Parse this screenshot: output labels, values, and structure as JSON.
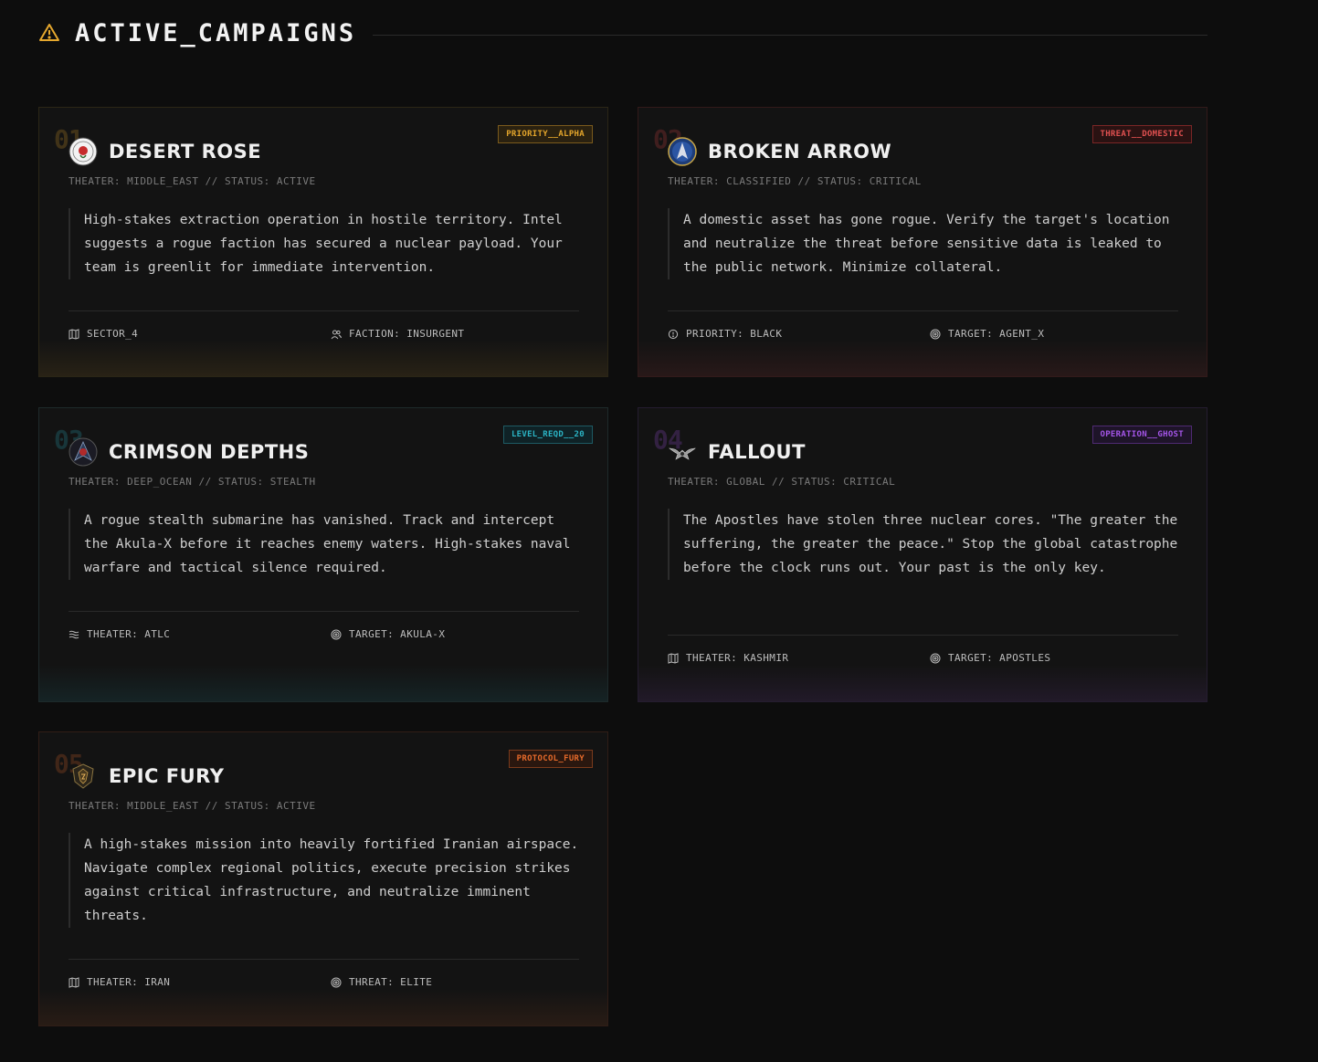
{
  "header": {
    "title": "ACTIVE_CAMPAIGNS"
  },
  "campaigns": [
    {
      "num": "01",
      "title": "DESERT ROSE",
      "meta": "THEATER: MIDDLE_EAST // STATUS: ACTIVE",
      "badge": "PRIORITY__ALPHA",
      "description": "High-stakes extraction operation in hostile territory. Intel suggests a rogue faction has secured a nuclear payload. Your team is greenlit for immediate intervention.",
      "foot_left": "SECTOR_4",
      "foot_right": "FACTION: INSURGENT",
      "accent": "#e2a42b"
    },
    {
      "num": "02",
      "title": "BROKEN ARROW",
      "meta": "THEATER: CLASSIFIED // STATUS: CRITICAL",
      "badge": "THREAT__DOMESTIC",
      "description": "A domestic asset has gone rogue. Verify the target's location and neutralize the threat before sensitive data is leaked to the public network. Minimize collateral.",
      "foot_left": "PRIORITY: BLACK",
      "foot_right": "TARGET: AGENT_X",
      "accent": "#e04848"
    },
    {
      "num": "03",
      "title": "CRIMSON DEPTHS",
      "meta": "THEATER: DEEP_OCEAN // STATUS: STEALTH",
      "badge": "LEVEL_REQD__20",
      "description": "A rogue stealth submarine has vanished. Track and intercept the Akula-X before it reaches enemy waters. High-stakes naval warfare and tactical silence required.",
      "foot_left": "THEATER: ATLC",
      "foot_right": "TARGET: AKULA-X",
      "accent": "#2bb3c4"
    },
    {
      "num": "04",
      "title": "FALLOUT",
      "meta": "THEATER: GLOBAL // STATUS: CRITICAL",
      "badge": "OPERATION__GHOST",
      "description": "The Apostles have stolen three nuclear cores. \"The greater the suffering, the greater the peace.\" Stop the global catastrophe before the clock runs out. Your past is the only key.",
      "foot_left": "THEATER: KASHMIR",
      "foot_right": "TARGET: APOSTLES",
      "accent": "#a455e8"
    },
    {
      "num": "05",
      "title": "EPIC FURY",
      "meta": "THEATER: MIDDLE_EAST // STATUS: ACTIVE",
      "badge": "PROTOCOL_FURY",
      "description": "A high-stakes mission into heavily fortified Iranian airspace. Navigate complex regional politics, execute precision strikes against critical infrastructure, and neutralize imminent threats.",
      "foot_left": "THEATER: IRAN",
      "foot_right": "THREAT: ELITE",
      "accent": "#e66a2a"
    }
  ]
}
